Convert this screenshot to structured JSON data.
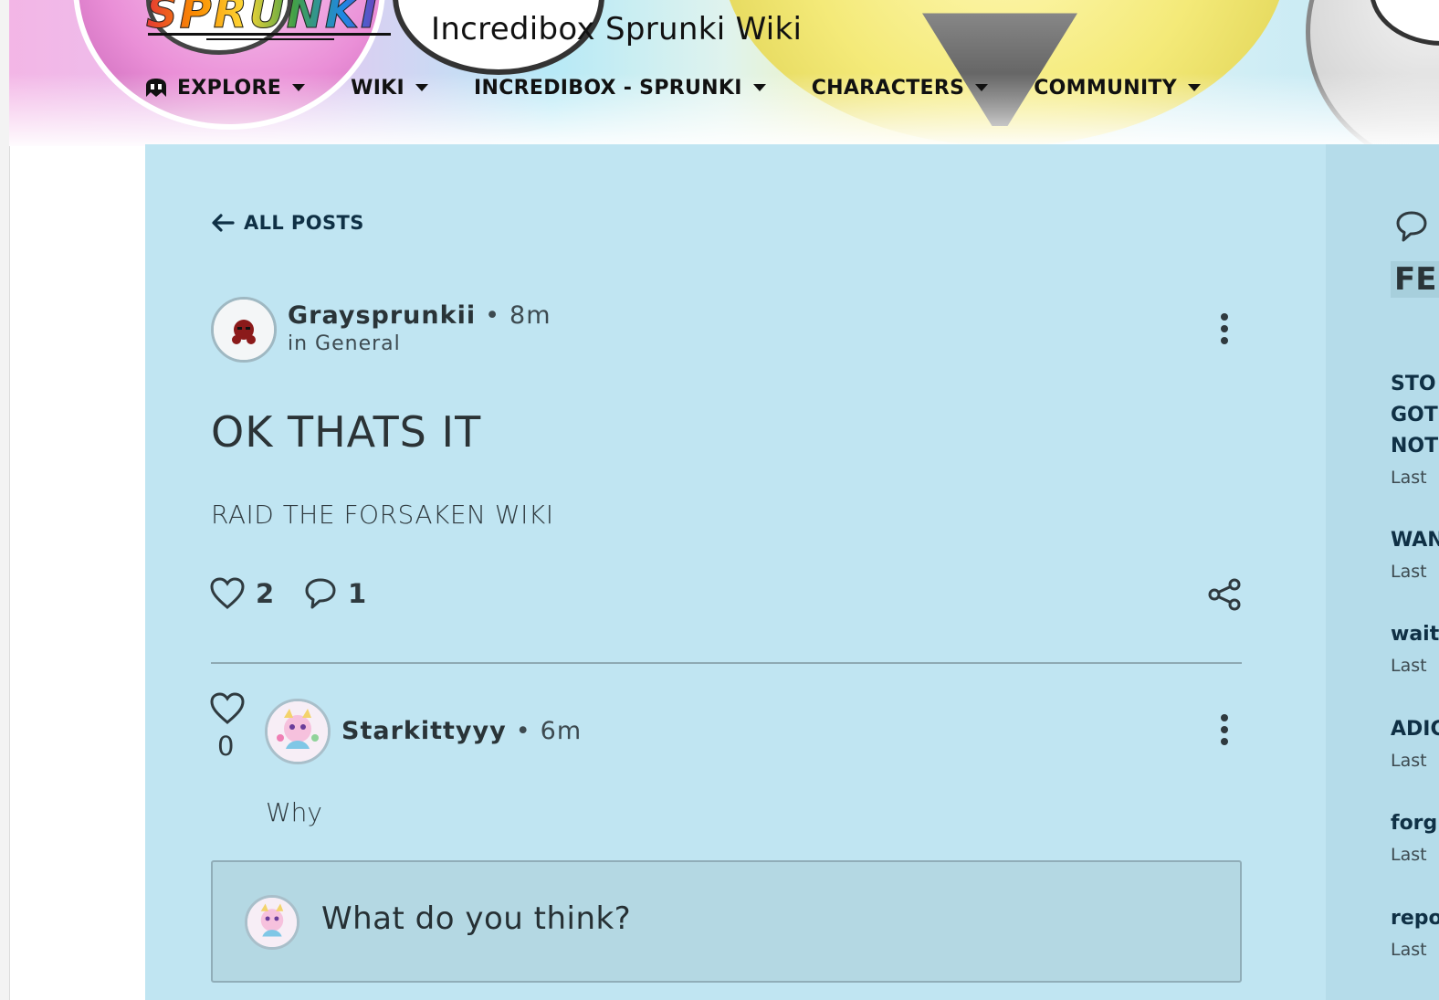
{
  "site": {
    "logo_text": "SPRUNKI",
    "title": "Incredibox Sprunki Wiki"
  },
  "nav": [
    {
      "label": "EXPLORE",
      "icon": "explore-ghost-icon"
    },
    {
      "label": "WIKI"
    },
    {
      "label": "INCREDIBOX - SPRUNKI"
    },
    {
      "label": "CHARACTERS"
    },
    {
      "label": "COMMUNITY"
    }
  ],
  "back": {
    "label": "ALL POSTS",
    "icon": "arrow-left-icon"
  },
  "post": {
    "author": "Graysprunkii",
    "separator": "•",
    "time": "8m",
    "category": "in General",
    "title": "OK THATS IT",
    "body": "RAID THE FORSAKEN WIKI",
    "likes": "2",
    "comments": "1"
  },
  "comment": {
    "author": "Starkittyyy",
    "separator": "•",
    "time": "6m",
    "likes": "0",
    "body": "Why"
  },
  "reply": {
    "placeholder": "What do you think?"
  },
  "rail": {
    "heading": "FE",
    "items": [
      {
        "lines": [
          "STO",
          "GOT",
          "NOT"
        ],
        "meta": "Last"
      },
      {
        "lines": [
          "WAN"
        ],
        "meta": "Last"
      },
      {
        "lines": [
          "wait"
        ],
        "meta": "Last"
      },
      {
        "lines": [
          "ADIC"
        ],
        "meta": "Last"
      },
      {
        "lines": [
          "forg"
        ],
        "meta": "Last"
      },
      {
        "lines": [
          "repo"
        ],
        "meta": "Last"
      }
    ]
  },
  "colors": {
    "card_bg": "#c0e5f2",
    "rail_bg": "#b5dcea",
    "link": "#0f3045",
    "text": "#2f3a3f"
  }
}
